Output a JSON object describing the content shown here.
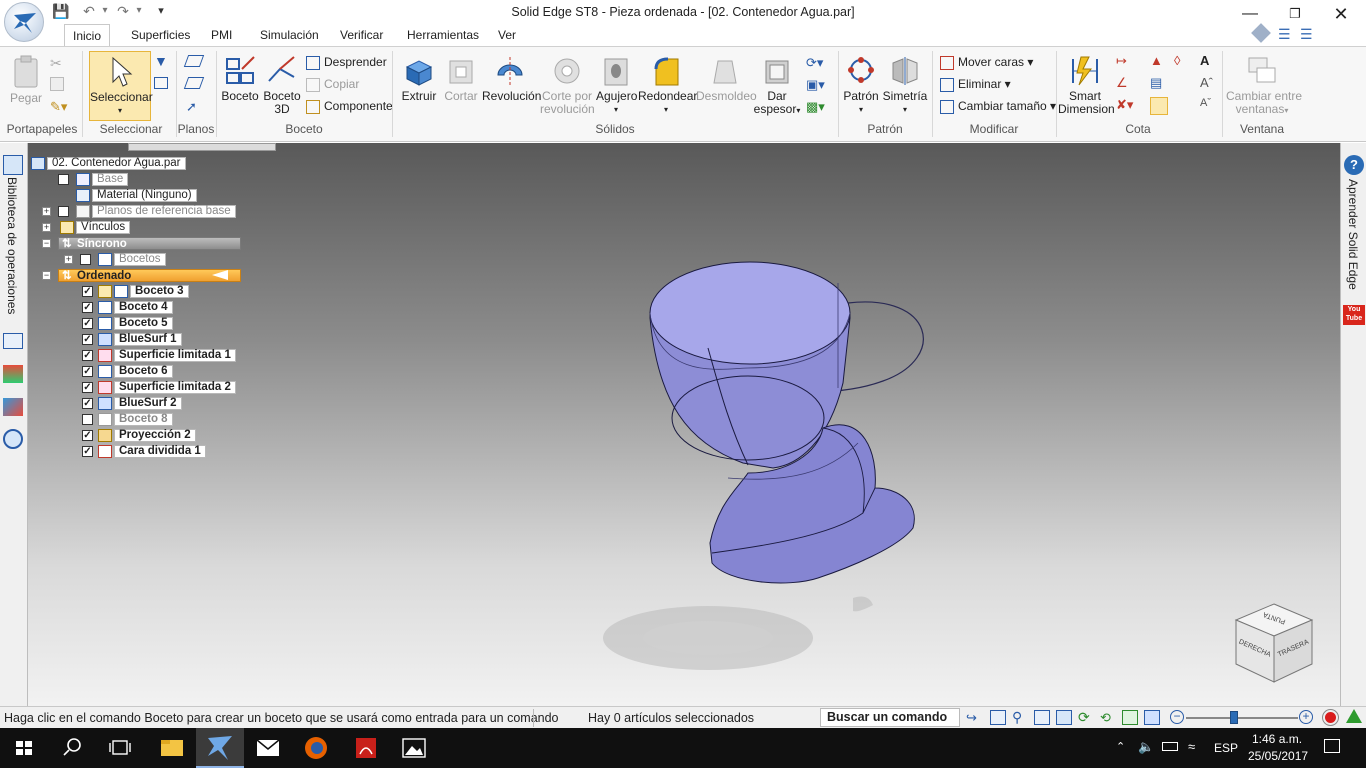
{
  "window": {
    "title": "Solid Edge ST8 - Pieza ordenada - [02. Contenedor Agua.par]",
    "minimize_icon": "minimize-icon",
    "maximize_icon": "restore-icon",
    "close_icon": "close-icon"
  },
  "tabs": [
    "Inicio",
    "Superficies",
    "PMI",
    "Simulación",
    "Verificar",
    "Herramientas",
    "Ver"
  ],
  "active_tab": "Inicio",
  "ribbon": {
    "portapapeles": {
      "label": "Portapapeles",
      "paste": "Pegar"
    },
    "seleccionar": {
      "label": "Seleccionar",
      "select": "Seleccionar"
    },
    "planos": {
      "label": "Planos"
    },
    "boceto": {
      "label": "Boceto",
      "sketch": "Boceto",
      "sketch3d_line1": "Boceto",
      "sketch3d_line2": "3D",
      "detach": "Desprender",
      "copy": "Copiar",
      "component": "Componente"
    },
    "solidos": {
      "label": "Sólidos",
      "extrude": "Extruir",
      "cut": "Cortar",
      "revolve": "Revolución",
      "revcut_line1": "Corte por",
      "revcut_line2": "revolución",
      "hole": "Agujero",
      "round": "Redondear",
      "draft": "Desmoldeo",
      "thin_line1": "Dar",
      "thin_line2": "espesor"
    },
    "patron": {
      "label": "Patrón",
      "pattern": "Patrón",
      "mirror": "Simetría"
    },
    "modificar": {
      "label": "Modificar",
      "move_faces": "Mover caras",
      "delete": "Eliminar",
      "resize": "Cambiar tamaño"
    },
    "cota": {
      "label": "Cota",
      "smart_line1": "Smart",
      "smart_line2": "Dimension"
    },
    "ventana": {
      "label": "Ventana",
      "switch_line1": "Cambiar entre",
      "switch_line2": "ventanas"
    }
  },
  "left_panel": {
    "vertical_label": "Biblioteca de operaciones"
  },
  "right_panel": {
    "vertical_label": "Aprender Solid Edge",
    "youtube": "You Tube"
  },
  "tree": {
    "root": "02. Contenedor Agua.par",
    "items": [
      {
        "label": "Base",
        "gray": true
      },
      {
        "label": "Material (Ninguno)"
      },
      {
        "label": "Planos de referencia base",
        "gray": true
      },
      {
        "label": "Vínculos"
      },
      {
        "label": "Síncrono"
      },
      {
        "label": "Bocetos",
        "gray": true
      },
      {
        "label": "Ordenado"
      }
    ],
    "features": [
      {
        "label": "Boceto 3",
        "checked": true
      },
      {
        "label": "Boceto 4",
        "checked": true
      },
      {
        "label": "Boceto 5",
        "checked": true
      },
      {
        "label": "BlueSurf 1",
        "checked": true
      },
      {
        "label": "Superficie limitada 1",
        "checked": true
      },
      {
        "label": "Boceto 6",
        "checked": true
      },
      {
        "label": "Superficie limitada 2",
        "checked": true
      },
      {
        "label": "BlueSurf 2",
        "checked": true
      },
      {
        "label": "Boceto 8",
        "checked": false
      },
      {
        "label": "Proyección 2",
        "checked": true
      },
      {
        "label": "Cara dividida 1",
        "checked": true
      }
    ]
  },
  "view_cube": {
    "top": "PUNTA",
    "left": "DERECHA",
    "right": "TRASERA"
  },
  "status": {
    "prompt": "Haga clic en el comando Boceto para crear un boceto que se usará como entrada para un comando",
    "selection": "Hay 0 artículos seleccionados",
    "search": "Buscar un comando"
  },
  "taskbar": {
    "language": "ESP",
    "time": "1:46 a.m.",
    "date": "25/05/2017"
  },
  "colors": {
    "accent_tab": "#f0a030",
    "model_surface": "#8f8fd8",
    "model_edge": "#1a1a40"
  }
}
